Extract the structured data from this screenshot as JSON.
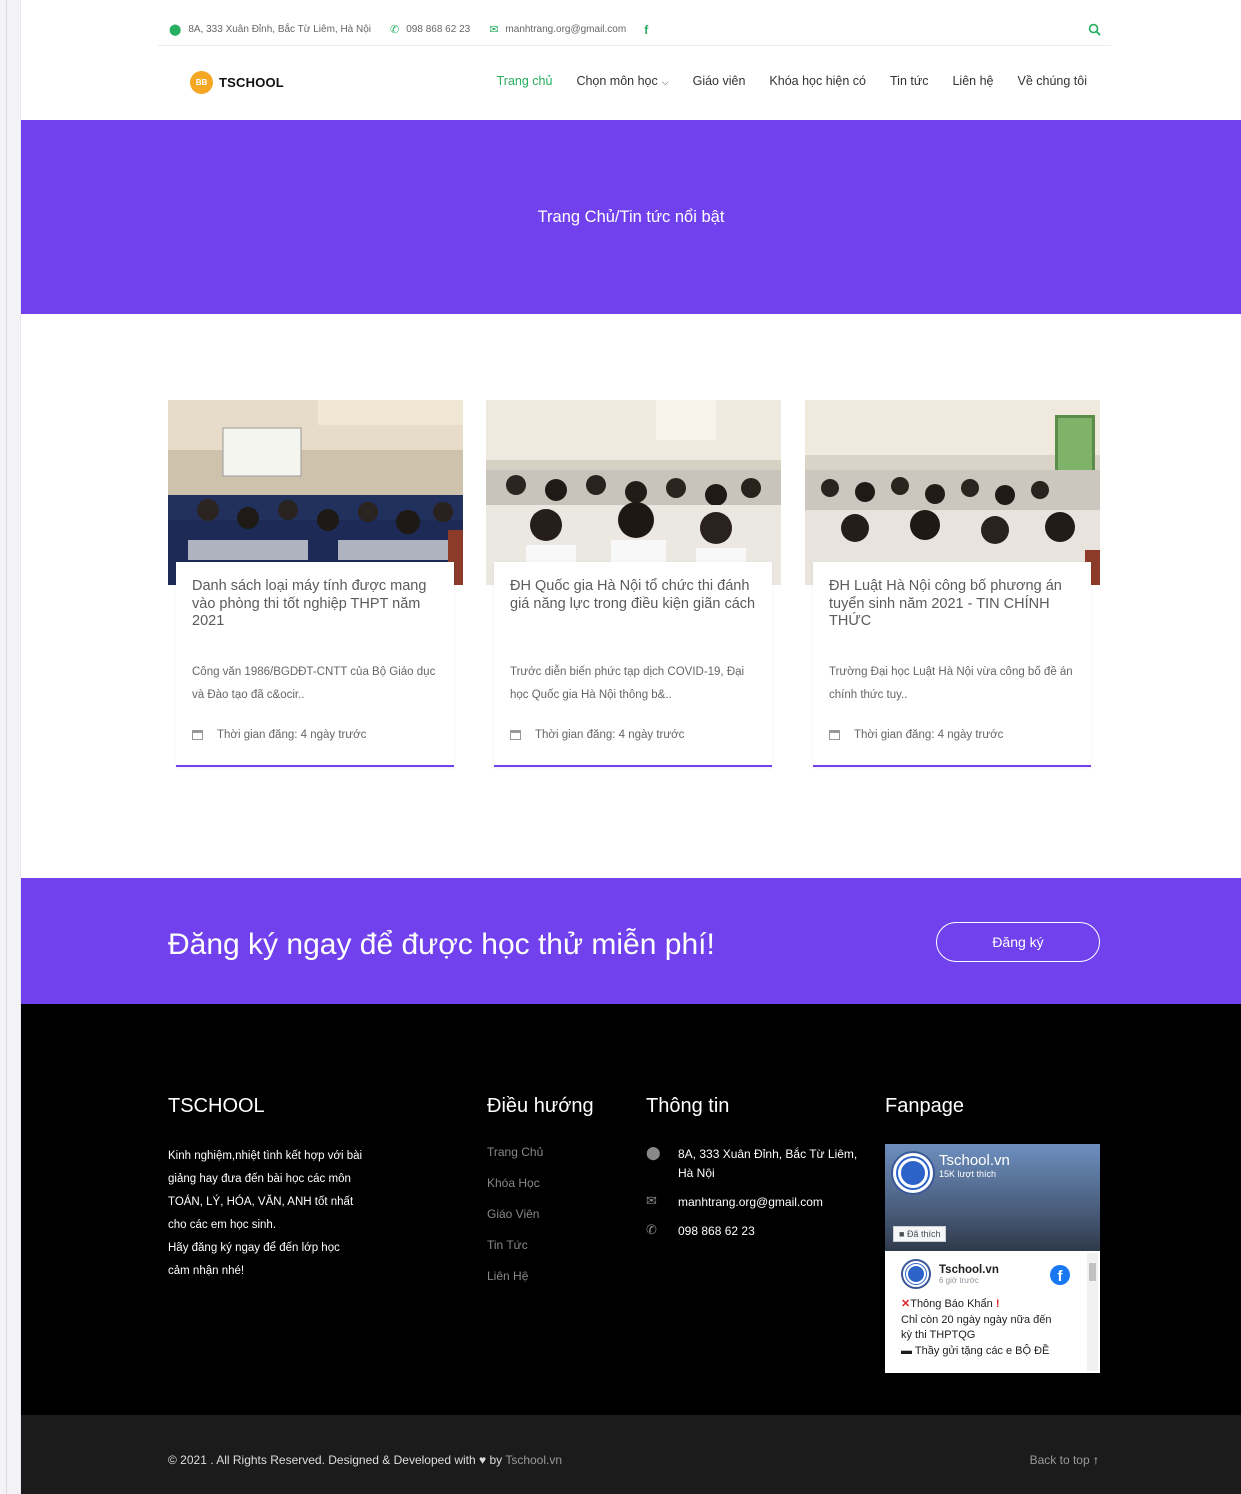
{
  "topbar": {
    "address": "8A, 333 Xuân Đỉnh, Bắc Từ Liêm, Hà Nội",
    "phone": "098 868 62 23",
    "email": "manhtrang.org@gmail.com",
    "facebook_label": "f"
  },
  "brand": {
    "logo_badge": "BB",
    "name": "TSCHOOL"
  },
  "nav": {
    "items": [
      "Trang chủ",
      "Chọn môn học",
      "Giáo viên",
      "Khóa học hiện có",
      "Tin tức",
      "Liên hệ",
      "Về chúng tôi"
    ],
    "caret": "⌵"
  },
  "hero": {
    "breadcrumb": "Trang Chủ/Tin tức nổi bật"
  },
  "posts": [
    {
      "title": "Danh sách loại máy tính được mang vào phòng thi tốt nghiệp THPT năm 2021",
      "excerpt": "Công văn 1986/BGDĐT-CNTT của Bộ Giáo dục và Đào tạo đã c&ocir..",
      "meta": "Thời gian đăng: 4 ngày trước"
    },
    {
      "title": "ĐH Quốc gia Hà Nội tổ chức thi đánh giá năng lực trong điều kiện giãn cách",
      "excerpt": "Trước diễn biến phức tạp dịch COVID-19, Đại học Quốc gia Hà Nội thông b&..",
      "meta": "Thời gian đăng: 4 ngày trước"
    },
    {
      "title": "ĐH Luật Hà Nội công bố phương án tuyển sinh năm 2021 - TIN CHÍNH THỨC",
      "excerpt": "Trường Đại học Luật Hà Nội vừa công bố đề án chính thức tuy..",
      "meta": "Thời gian đăng: 4 ngày trước"
    }
  ],
  "cta": {
    "heading": "Đăng ký ngay để được học thử miễn phí!",
    "button": "Đăng ký"
  },
  "footer": {
    "brand_title": "TSCHOOL",
    "about": [
      "Kinh nghiệm,nhiệt tình kết hợp với bài",
      "giảng hay đưa đến bài học các môn",
      "TOÁN, LÝ, HÓA, VĂN, ANH tốt nhất",
      "cho các em học sinh.",
      "Hãy đăng ký ngay để đến lớp học",
      "cảm nhận nhé!"
    ],
    "nav_title": "Điều hướng",
    "nav_items": [
      "Trang Chủ",
      "Khóa Học",
      "Giáo Viên",
      "Tin Tức",
      "Liên Hệ"
    ],
    "info_title": "Thông tin",
    "info": {
      "address_1": "8A, 333 Xuân Đỉnh, Bắc Từ Liêm,",
      "address_2": "Hà Nội",
      "email": "manhtrang.org@gmail.com",
      "phone": "098 868 62 23"
    },
    "fanpage_title": "Fanpage",
    "fanpage": {
      "page_name": "Tschool.vn",
      "likes": "15K lượt thích",
      "like_button": "Đã thích",
      "post_author": "Tschool.vn",
      "post_time": "6 giờ trước",
      "post_lines": [
        "Thông Báo Khẩn",
        "Chỉ còn 20 ngày ngày nữa đến",
        "kỳ thi THPTQG",
        "Thầy gửi tặng các e BỘ ĐỀ"
      ]
    }
  },
  "bottom": {
    "copyright": "© 2021 . All Rights Reserved. Designed & Developed with",
    "heart": "♥",
    "by": "by",
    "link": "Tschool.vn",
    "back_to_top": "Back to top",
    "arrow": "↑"
  }
}
